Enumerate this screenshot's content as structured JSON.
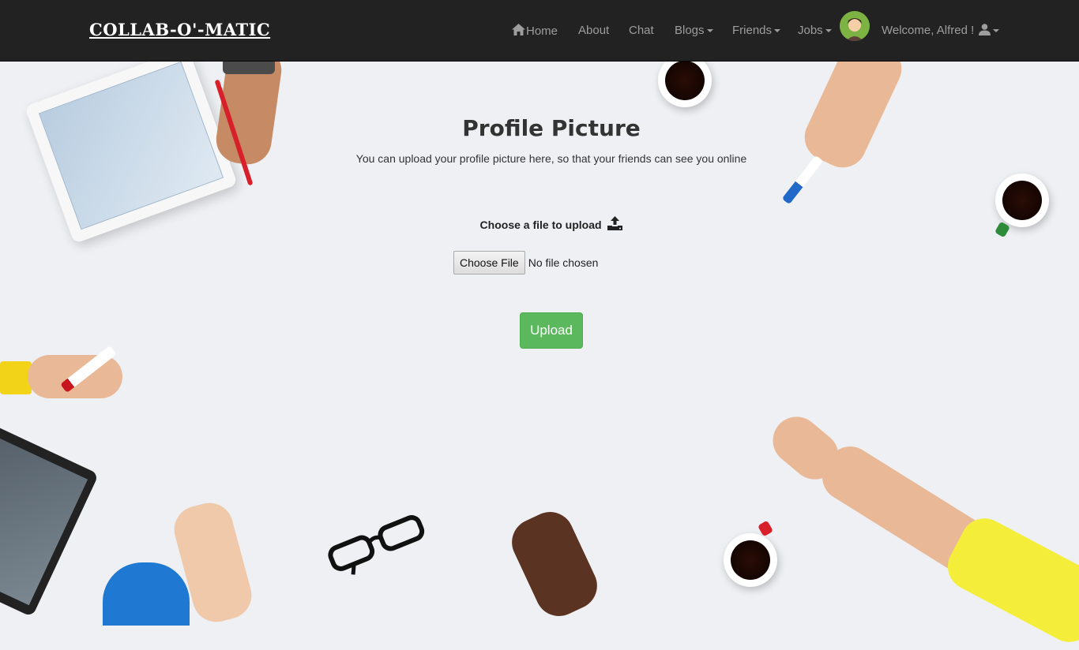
{
  "brand": "COLLAB-O'-MATIC",
  "nav": {
    "home": "Home",
    "about": "About",
    "chat": "Chat",
    "blogs": "Blogs",
    "friends": "Friends",
    "jobs": "Jobs",
    "welcome": "Welcome, Alfred !"
  },
  "icons": {
    "home": "home-icon",
    "avatar": "avatar",
    "user": "user-icon",
    "upload": "upload-icon"
  },
  "colors": {
    "navbar_bg": "#222222",
    "nav_text": "#9d9d9d",
    "upload_button": "#5cb85c",
    "page_bg": "#eef0f4"
  },
  "main": {
    "title": "Profile Picture",
    "subtitle": "You can upload your profile picture here, so that your friends can see you online",
    "choose_label": "Choose a file to upload",
    "file_button": "Choose File",
    "file_status": "No file chosen",
    "upload_button": "Upload"
  }
}
